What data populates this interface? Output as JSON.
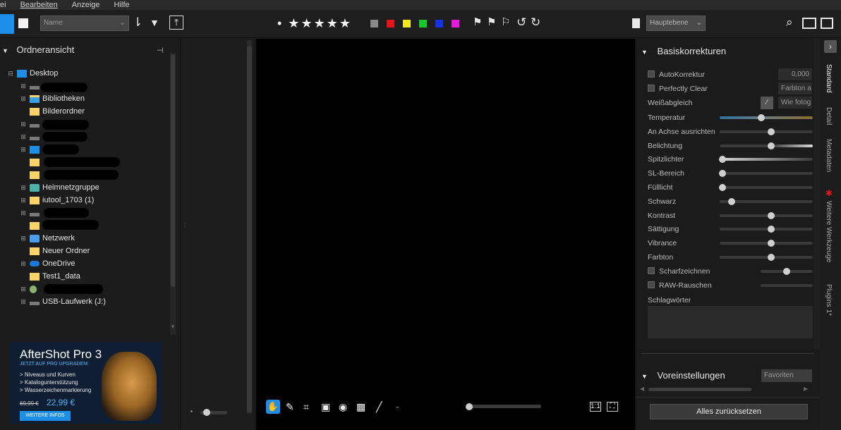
{
  "menu": [
    "ei",
    "Bearbeiten",
    "Anzeige",
    "Hilfe"
  ],
  "toolbar": {
    "sort_value": "Name",
    "stars": "• ★★★★★",
    "color_labels": [
      "#8a8a8a",
      "#e8141b",
      "#f5e71a",
      "#19c72a",
      "#1431e6",
      "#e61ae0"
    ],
    "layer_value": "Hauptebene",
    "icons": [
      "grid-view-icon",
      "single-view-icon",
      "sort-icon",
      "filter-icon",
      "export-icon",
      "flag-icon",
      "reject-flag-icon",
      "unflag-icon",
      "rotate-left-icon",
      "rotate-right-icon",
      "clipboard-icon",
      "search-icon",
      "slideshow-icon",
      "fullscreen-icon"
    ]
  },
  "left": {
    "header": "Ordneransicht",
    "tree": [
      {
        "label": "Desktop",
        "icon": "desktop-icon",
        "indent": 0
      },
      {
        "label": "",
        "icon": "drive-icon",
        "indent": 1
      },
      {
        "label": "Bibliotheken",
        "icon": "library-icon",
        "indent": 1
      },
      {
        "label": "Bilderordner",
        "icon": "folder-icon",
        "indent": 1
      },
      {
        "label": "",
        "icon": "drive-icon",
        "indent": 1
      },
      {
        "label": "",
        "icon": "drive-icon",
        "indent": 1
      },
      {
        "label": "",
        "icon": "computer-icon",
        "indent": 1
      },
      {
        "label": "",
        "icon": "folder-icon",
        "indent": 1
      },
      {
        "label": "",
        "icon": "folder-icon",
        "indent": 1
      },
      {
        "label": "Heimnetzgruppe",
        "icon": "homegroup-icon",
        "indent": 1
      },
      {
        "label": "iutool_1703 (1)",
        "icon": "folder-icon",
        "indent": 1
      },
      {
        "label": ")",
        "icon": "drive-icon",
        "indent": 1
      },
      {
        "label": "",
        "icon": "folder-icon",
        "indent": 1
      },
      {
        "label": "Netzwerk",
        "icon": "network-icon",
        "indent": 1
      },
      {
        "label": "Neuer Ordner",
        "icon": "folder-icon",
        "indent": 1
      },
      {
        "label": "OneDrive",
        "icon": "cloud-icon",
        "indent": 1
      },
      {
        "label": "Test1_data",
        "icon": "folder-icon",
        "indent": 1
      },
      {
        "label": "",
        "icon": "user-icon",
        "indent": 1
      },
      {
        "label": "USB-Laufwerk (J:)",
        "icon": "drive-icon",
        "indent": 1
      }
    ]
  },
  "promo": {
    "title": "AfterShot Pro 3",
    "subtitle": "JETZT AUF PRO UPGRADEN!",
    "bullets": [
      "> Niveaus und Kurven",
      "> Katalogunterstützung",
      "> Wasserzeichenmarkierung"
    ],
    "old_price": "69,99 €",
    "new_price": "22,99 €",
    "button": "WEITERE INFOS"
  },
  "right": {
    "header": "Basiskorrekturen",
    "auto_label": "AutoKorrektur",
    "auto_value": "0,000",
    "clear_label": "Perfectly Clear",
    "clear_value": "Farbton a",
    "wb_label": "Weißabgleich",
    "wb_value": "Wie fotog",
    "sliders": [
      {
        "label": "Temperatur",
        "value": 0.45
      },
      {
        "label": "An Achse ausrichten",
        "value": 0.55
      },
      {
        "label": "Belichtung",
        "value": 0.55
      },
      {
        "label": "Spitzlichter",
        "value": 0.03
      },
      {
        "label": "SL-Bereich",
        "value": 0.03
      },
      {
        "label": "Fülllicht",
        "value": 0.03
      },
      {
        "label": "Schwarz",
        "value": 0.13
      },
      {
        "label": "Kontrast",
        "value": 0.55
      },
      {
        "label": "Sättigung",
        "value": 0.55
      },
      {
        "label": "Vibrance",
        "value": 0.55
      },
      {
        "label": "Farbton",
        "value": 0.55
      }
    ],
    "sharpen_label": "Scharfzeichnen",
    "sharpen_value": 0.5,
    "raw_label": "RAW-Rauschen",
    "keywords_label": "Schlagwörter",
    "presets_header": "Voreinstellungen",
    "presets_value": "Favoriten",
    "reset_label": "Alles zurücksetzen"
  },
  "side_tabs": [
    "Standard",
    "Detail",
    "Metadaten",
    "Weitere Werkzeuge",
    "Plugins 1*"
  ]
}
